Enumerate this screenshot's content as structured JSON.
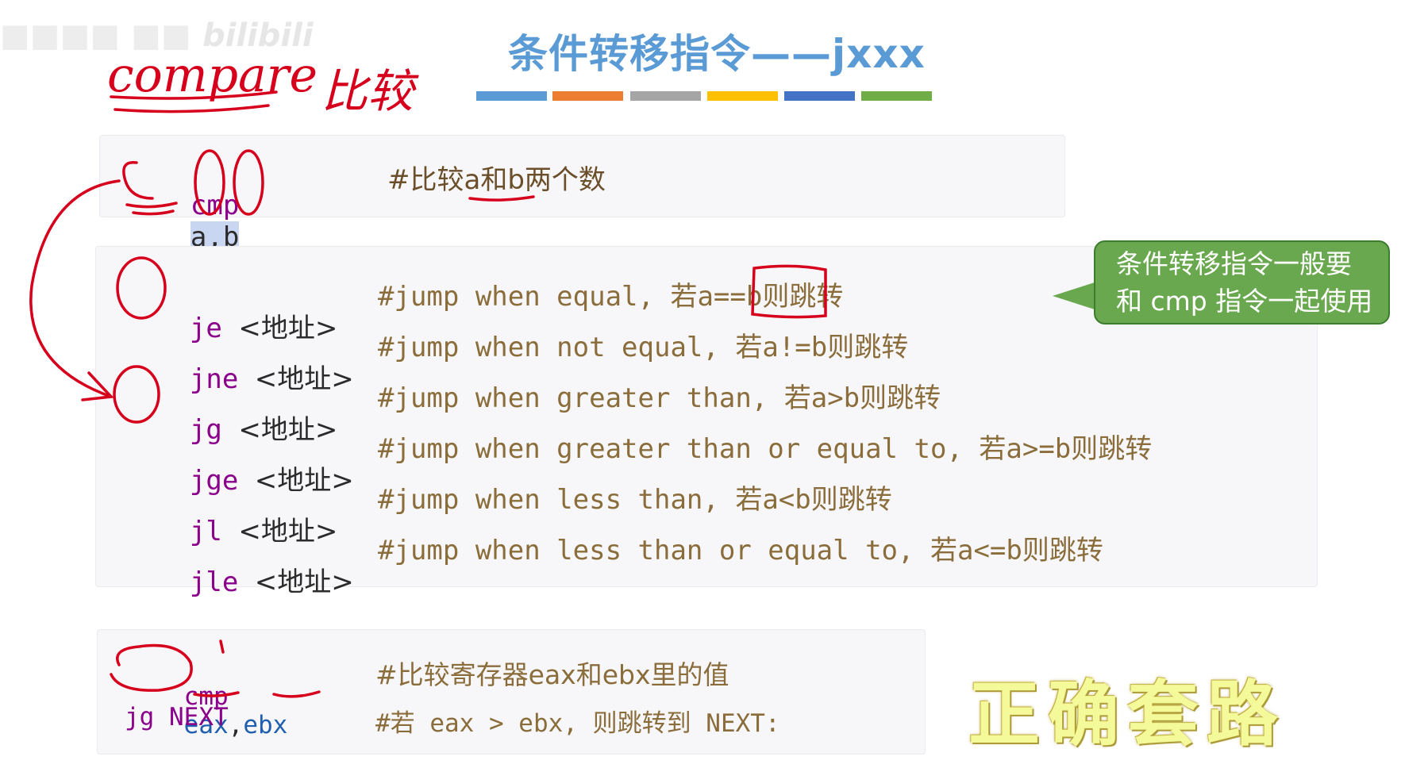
{
  "watermark": {
    "text": "■■■■ ■■",
    "logo": "bilibili"
  },
  "title": "条件转移指令——jxxx",
  "color_bar": [
    "#5b9bd5",
    "#ed7d31",
    "#a5a5a5",
    "#ffc000",
    "#4472c4",
    "#70ad47"
  ],
  "handwriting": {
    "compare": "compare",
    "bijiao": "比较"
  },
  "cmp_block": {
    "instr": "cmp",
    "operands": "a,b",
    "comment": "#比较a和b两个数"
  },
  "jump_block": {
    "addr": "<地址>",
    "rows": [
      {
        "instr": "je",
        "comment": "#jump when equal, 若a==b则跳转"
      },
      {
        "instr": "jne",
        "comment": "#jump when not equal, 若a!=b则跳转"
      },
      {
        "instr": "jg",
        "comment": "#jump when greater than, 若a>b则跳转"
      },
      {
        "instr": "jge",
        "comment": "#jump when greater than or equal to, 若a>=b则跳转"
      },
      {
        "instr": "jl",
        "comment": "#jump when less than, 若a<b则跳转"
      },
      {
        "instr": "jle",
        "comment": "#jump when less than or equal to, 若a<=b则跳转"
      }
    ]
  },
  "callout": {
    "line1": "条件转移指令一般要",
    "line2": "和 cmp 指令一起使用"
  },
  "example_block": {
    "line1_instr": "cmp",
    "line1_reg1": "eax",
    "line1_sep": ",",
    "line1_reg2": "ebx",
    "line1_comment": "#比较寄存器eax和ebx里的值",
    "line2_instr": "jg NEXT",
    "line2_comment": "#若 eax > ebx, 则跳转到 NEXT:"
  },
  "routine_label": "正确套路"
}
